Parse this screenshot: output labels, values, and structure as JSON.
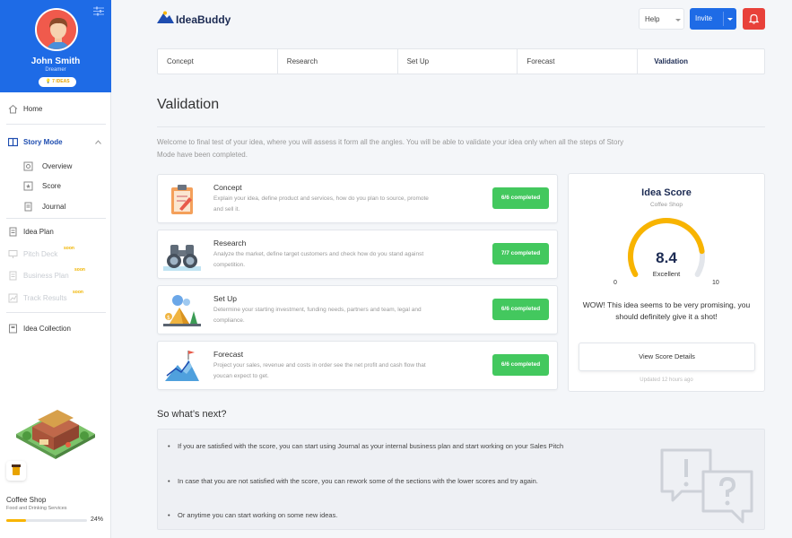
{
  "app": {
    "logo_text": "IdeaBuddy"
  },
  "profile": {
    "name": "John Smith",
    "role": "Dreamer",
    "ideas_badge": "7 IDEAS"
  },
  "sidebar": {
    "home": "Home",
    "story_mode": "Story Mode",
    "overview": "Overview",
    "score": "Score",
    "journal": "Journal",
    "idea_plan": "Idea Plan",
    "pitch_deck": "Pitch Deck",
    "business_plan": "Business Plan",
    "track_results": "Track Results",
    "soon": "soon",
    "idea_collection": "Idea Collection"
  },
  "project": {
    "name": "Coffee Shop",
    "type": "Food and Drinking Services",
    "progress": 24,
    "progress_label": "24%"
  },
  "header": {
    "help": "Help",
    "invite": "Invite"
  },
  "tabs": [
    "Concept",
    "Research",
    "Set Up",
    "Forecast",
    "Validation"
  ],
  "page": {
    "title": "Validation",
    "intro": "Welcome to final test of your idea, where you will assess it form all the angles. You will be able to validate your idea only when all the steps of Story Mode have been completed."
  },
  "cards": [
    {
      "title": "Concept",
      "desc": "Explain your idea, define product and services, how do you plan to source, promote and sell it.",
      "badge": "6/6 completed"
    },
    {
      "title": "Research",
      "desc": "Analyze the market, define target customers and check how do you stand against competition.",
      "badge": "7/7 completed"
    },
    {
      "title": "Set Up",
      "desc": "Determine your starting investment, funding needs, partners and team, legal and compliance.",
      "badge": "6/6 completed"
    },
    {
      "title": "Forecast",
      "desc": "Project your sales, revenue and costs in order see the net profit and cash flow that youcan expect to get.",
      "badge": "6/6 completed"
    }
  ],
  "score": {
    "title": "Idea Score",
    "subtitle": "Coffee Shop",
    "value": "8.4",
    "value_num": 8.4,
    "label": "Excellent",
    "min": "0",
    "max": "10",
    "message": "WOW! This idea seems to be very promising, you should definitely give it a shot!",
    "button": "View Score Details",
    "updated": "Updated 12 hours ago"
  },
  "next": {
    "title": "So what’s next?",
    "items": [
      "If you are satisfied with the score, you can start using Journal as your internal business plan and start working on your Sales Pitch",
      "In case that you are not satisfied with the score, you can rework some of the sections with the lower scores and try again.",
      "Or anytime you can start working on some new ideas."
    ]
  },
  "colors": {
    "primary": "#1e6be6",
    "success": "#43c85e",
    "accent": "#f8b400",
    "alert": "#e8413a"
  }
}
